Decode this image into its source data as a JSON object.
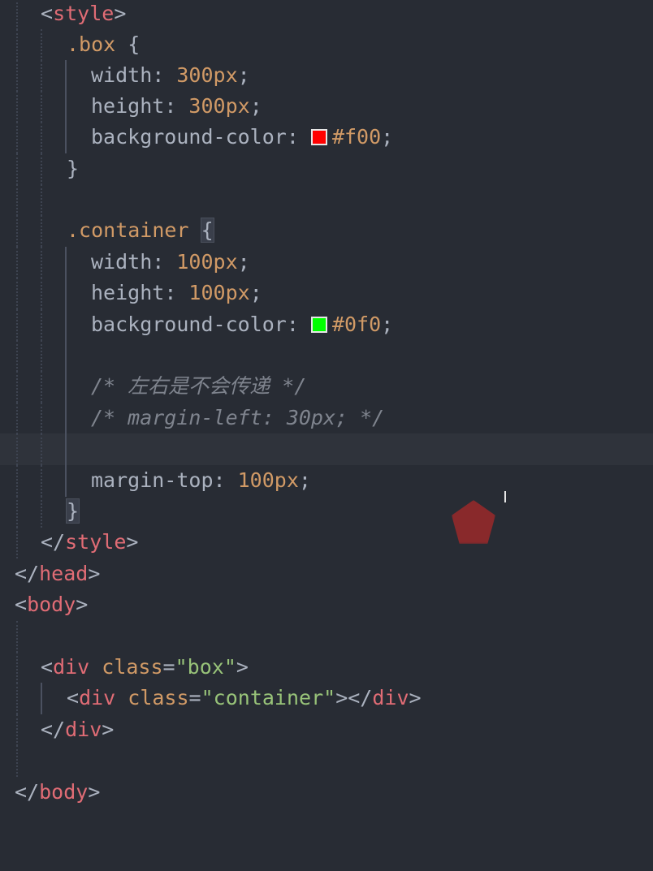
{
  "editor": {
    "theme_colors": {
      "background": "#282c34",
      "tag": "#e06c75",
      "string": "#98c379",
      "number": "#d19a66",
      "comment": "#7f848e",
      "swatch_red": "#ff0000",
      "swatch_green": "#00ff00"
    },
    "lines": {
      "l1": {
        "open": "<",
        "tag": "style",
        "close": ">"
      },
      "l2": {
        "selector": ".box",
        "brace": " {"
      },
      "l3": {
        "prop": "width",
        "colon": ": ",
        "value": "300px",
        "semi": ";"
      },
      "l4": {
        "prop": "height",
        "colon": ": ",
        "value": "300px",
        "semi": ";"
      },
      "l5": {
        "prop": "background-color",
        "colon": ": ",
        "value": "#f00",
        "semi": ";"
      },
      "l6": {
        "brace": "}"
      },
      "l8": {
        "selector": ".container",
        "space": " ",
        "brace": "{"
      },
      "l9": {
        "prop": "width",
        "colon": ": ",
        "value": "100px",
        "semi": ";"
      },
      "l10": {
        "prop": "height",
        "colon": ": ",
        "value": "100px",
        "semi": ";"
      },
      "l11": {
        "prop": "background-color",
        "colon": ": ",
        "value": "#0f0",
        "semi": ";"
      },
      "l13": {
        "comment": "/* 左右是不会传递 */"
      },
      "l14": {
        "comment": "/* margin-left: 30px; */"
      },
      "l16": {
        "prop": "margin-top",
        "colon": ": ",
        "value": "100px",
        "semi": ";"
      },
      "l17": {
        "brace": "}"
      },
      "l18": {
        "open": "</",
        "tag": "style",
        "close": ">"
      },
      "l19": {
        "open": "</",
        "tag": "head",
        "close": ">"
      },
      "l20": {
        "open": "<",
        "tag": "body",
        "close": ">"
      },
      "l22": {
        "open": "<",
        "tag": "div",
        "space": " ",
        "attr": "class",
        "eq": "=",
        "val": "\"box\"",
        "close": ">"
      },
      "l23": {
        "open": "<",
        "tag": "div",
        "space": " ",
        "attr": "class",
        "eq": "=",
        "val": "\"container\"",
        "close": ">",
        "open2": "</",
        "tag2": "div",
        "close2": ">"
      },
      "l24": {
        "open": "</",
        "tag": "div",
        "close": ">"
      },
      "l26": {
        "open": "</",
        "tag": "body",
        "close": ">"
      }
    }
  }
}
